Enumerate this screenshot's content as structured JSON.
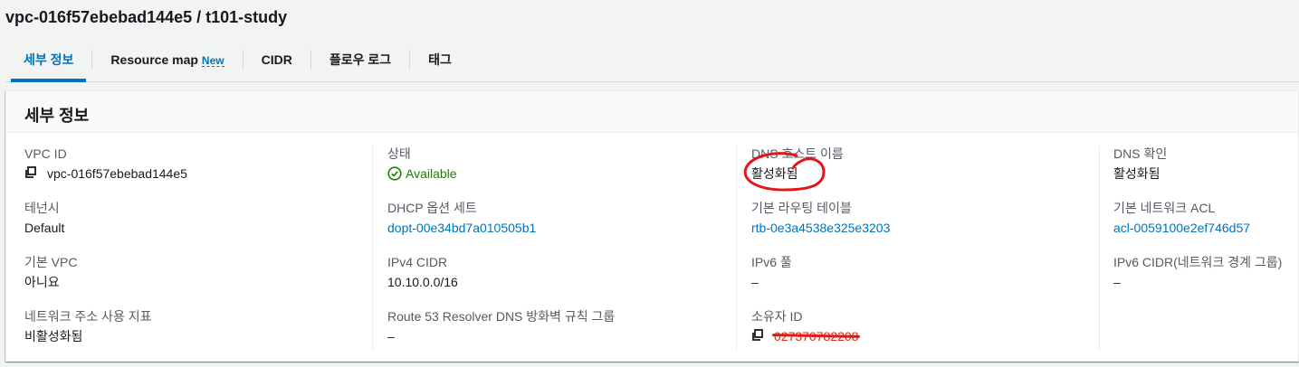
{
  "page": {
    "title": "vpc-016f57ebebad144e5 / t101-study"
  },
  "tabs": [
    {
      "label": "세부 정보",
      "active": true
    },
    {
      "label": "Resource map",
      "badge": "New"
    },
    {
      "label": "CIDR"
    },
    {
      "label": "플로우 로그"
    },
    {
      "label": "태그"
    }
  ],
  "panel": {
    "title": "세부 정보",
    "columns": [
      [
        {
          "label": "VPC ID",
          "value": "vpc-016f57ebebad144e5"
        },
        {
          "label": "테넌시",
          "value": "Default"
        },
        {
          "label": "기본 VPC",
          "value": "아니요"
        },
        {
          "label": "네트워크 주소 사용 지표",
          "value": "비활성화됨"
        }
      ],
      [
        {
          "label": "상태",
          "value": "Available"
        },
        {
          "label": "DHCP 옵션 세트",
          "value": "dopt-00e34bd7a010505b1"
        },
        {
          "label": "IPv4 CIDR",
          "value": "10.10.0.0/16"
        },
        {
          "label": "Route 53 Resolver DNS 방화벽 규칙 그룹",
          "value": "–"
        }
      ],
      [
        {
          "label": "DNS 호스트 이름",
          "value": "활성화됨"
        },
        {
          "label": "기본 라우팅 테이블",
          "value": "rtb-0e3a4538e325e3203"
        },
        {
          "label": "IPv6 풀",
          "value": "–"
        },
        {
          "label": "소유자 ID",
          "value": "027370782208"
        }
      ],
      [
        {
          "label": "DNS 확인",
          "value": "활성화됨"
        },
        {
          "label": "기본 네트워크 ACL",
          "value": "acl-0059100e2ef746d57"
        },
        {
          "label": "IPv6 CIDR(네트워크 경계 그룹)",
          "value": "–"
        }
      ]
    ]
  },
  "colors": {
    "link": "#0073bb",
    "success": "#1d8102",
    "annotation": "#e0181b"
  }
}
